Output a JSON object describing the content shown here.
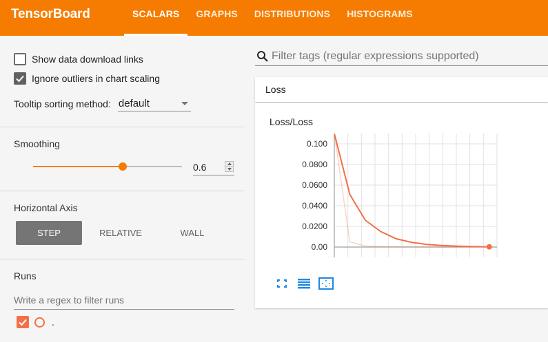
{
  "app": {
    "title": "TensorBoard"
  },
  "tabs": [
    {
      "label": "SCALARS",
      "active": true
    },
    {
      "label": "GRAPHS",
      "active": false
    },
    {
      "label": "DISTRIBUTIONS",
      "active": false
    },
    {
      "label": "HISTOGRAMS",
      "active": false
    }
  ],
  "sidebar": {
    "show_download_links": {
      "label": "Show data download links",
      "checked": false
    },
    "ignore_outliers": {
      "label": "Ignore outliers in chart scaling",
      "checked": true
    },
    "tooltip_sort": {
      "label": "Tooltip sorting method:",
      "value": "default"
    },
    "smoothing": {
      "title": "Smoothing",
      "value": "0.6",
      "fraction": 0.6
    },
    "horizontal_axis": {
      "title": "Horizontal Axis",
      "options": [
        {
          "label": "STEP",
          "active": true
        },
        {
          "label": "RELATIVE",
          "active": false
        },
        {
          "label": "WALL",
          "active": false
        }
      ]
    },
    "runs": {
      "title": "Runs",
      "filter_placeholder": "Write a regex to filter runs",
      "items": [
        {
          "label": ".",
          "checked": true,
          "color": "#f36f45"
        }
      ]
    }
  },
  "main": {
    "filter_placeholder": "Filter tags (regular expressions supported)",
    "group_title": "Loss"
  },
  "colors": {
    "accent": "#f57c00",
    "run": "#f36f45",
    "tool_blue": "#1e88e5"
  },
  "icons": {
    "search": "search-icon",
    "expand": "fullscreen-icon",
    "lines": "toggle-lines-icon",
    "fit": "fit-domain-icon"
  },
  "chart_data": {
    "type": "line",
    "title": "Loss/Loss",
    "xlabel": "",
    "ylabel": "",
    "y_ticks": [
      "0.100",
      "0.0800",
      "0.0600",
      "0.0400",
      "0.0200",
      "0.00"
    ],
    "ylim": [
      -0.01,
      0.11
    ],
    "xlim": [
      0,
      10.5
    ],
    "grid": true,
    "legend": "none",
    "series": [
      {
        "smoothed": true,
        "x": [
          0,
          1,
          2,
          3,
          4,
          5,
          6,
          7,
          8,
          9,
          10
        ],
        "values": [
          0.11,
          0.051,
          0.026,
          0.015,
          0.008,
          0.0045,
          0.0025,
          0.0014,
          0.0008,
          0.0004,
          0.0002
        ]
      },
      {
        "smoothed": false,
        "x": [
          0,
          1,
          2,
          3,
          4,
          5,
          6,
          7,
          8,
          9,
          10
        ],
        "values": [
          0.11,
          0.005,
          0.001,
          0.0005,
          0.0003,
          0.0002,
          0.0001,
          0.0001,
          0.0001,
          0.0001,
          0.0001
        ]
      }
    ]
  }
}
